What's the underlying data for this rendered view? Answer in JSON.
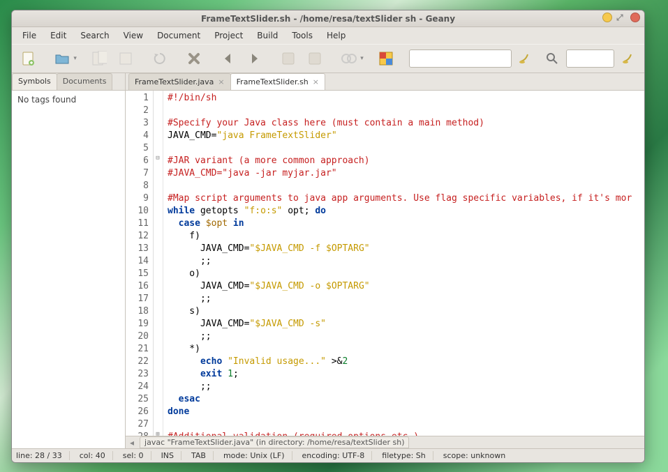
{
  "window": {
    "title": "FrameTextSlider.sh - /home/resa/textSlider sh - Geany"
  },
  "menu": {
    "items": [
      "File",
      "Edit",
      "Search",
      "View",
      "Document",
      "Project",
      "Build",
      "Tools",
      "Help"
    ]
  },
  "toolbar": {
    "icons": [
      "new-file",
      "open-file",
      "save-file",
      "save-all",
      "revert",
      "close",
      "undo",
      "redo",
      "back",
      "forward",
      "compile",
      "build",
      "execute",
      "color-picker"
    ],
    "search_placeholder": "",
    "search_value": "",
    "goto_placeholder": "",
    "goto_value": ""
  },
  "sidebar": {
    "tabs": [
      "Symbols",
      "Documents"
    ],
    "active_tab": 0,
    "content": "No tags found"
  },
  "editor_tabs": [
    {
      "label": "FrameTextSlider.java",
      "active": false
    },
    {
      "label": "FrameTextSlider.sh",
      "active": true
    }
  ],
  "code_lines": [
    {
      "n": 1,
      "t": "comment",
      "text": "#!/bin/sh"
    },
    {
      "n": 2,
      "t": "blank",
      "text": ""
    },
    {
      "n": 3,
      "t": "comment",
      "text": "#Specify your Java class here (must contain a main method)"
    },
    {
      "n": 4,
      "t": "assign",
      "lhs": "JAVA_CMD=",
      "str": "\"java FrameTextSlider\""
    },
    {
      "n": 5,
      "t": "blank",
      "text": ""
    },
    {
      "n": 6,
      "t": "comment",
      "text": "#JAR variant (a more common approach)",
      "fold": "minus"
    },
    {
      "n": 7,
      "t": "comment",
      "text": "#JAVA_CMD=\"java -jar myjar.jar\""
    },
    {
      "n": 8,
      "t": "blank",
      "text": ""
    },
    {
      "n": 9,
      "t": "comment",
      "text": "#Map script arguments to java app arguments. Use flag specific variables, if it's mor"
    },
    {
      "n": 10,
      "t": "while",
      "kw1": "while",
      "mid": " getopts ",
      "str": "\"f:o:s\"",
      "mid2": " opt; ",
      "kw2": "do"
    },
    {
      "n": 11,
      "t": "case",
      "indent": "  ",
      "kw1": "case ",
      "var": "$opt",
      "kw2": " in"
    },
    {
      "n": 12,
      "t": "plain",
      "text": "    f)"
    },
    {
      "n": 13,
      "t": "assign2",
      "indent": "      ",
      "lhs": "JAVA_CMD=",
      "str": "\"$JAVA_CMD -f $OPTARG\""
    },
    {
      "n": 14,
      "t": "plain",
      "text": "      ;;"
    },
    {
      "n": 15,
      "t": "plain",
      "text": "    o)"
    },
    {
      "n": 16,
      "t": "assign2",
      "indent": "      ",
      "lhs": "JAVA_CMD=",
      "str": "\"$JAVA_CMD -o $OPTARG\""
    },
    {
      "n": 17,
      "t": "plain",
      "text": "      ;;"
    },
    {
      "n": 18,
      "t": "plain",
      "text": "    s)"
    },
    {
      "n": 19,
      "t": "assign2",
      "indent": "      ",
      "lhs": "JAVA_CMD=",
      "str": "\"$JAVA_CMD -s\""
    },
    {
      "n": 20,
      "t": "plain",
      "text": "      ;;"
    },
    {
      "n": 21,
      "t": "plain",
      "text": "    *)"
    },
    {
      "n": 22,
      "t": "echo",
      "indent": "      ",
      "kw": "echo ",
      "str": "\"Invalid usage...\"",
      "rest": " >&",
      "num": "2"
    },
    {
      "n": 23,
      "t": "exit",
      "indent": "      ",
      "kw": "exit ",
      "num": "1",
      "rest": ";"
    },
    {
      "n": 24,
      "t": "plain",
      "text": "      ;;"
    },
    {
      "n": 25,
      "t": "kw",
      "indent": "  ",
      "kw": "esac"
    },
    {
      "n": 26,
      "t": "kw",
      "indent": "",
      "kw": "done"
    },
    {
      "n": 27,
      "t": "blank",
      "text": ""
    },
    {
      "n": 28,
      "t": "comment",
      "text": "#Additional validation (required options etc.)",
      "fold": "plus"
    }
  ],
  "bottom_message": "javac \"FrameTextSlider.java\" (in directory: /home/resa/textSlider sh)",
  "status": {
    "line": "line: 28 / 33",
    "col": "col: 40",
    "sel": "sel: 0",
    "ins": "INS",
    "tab": "TAB",
    "mode": "mode: Unix (LF)",
    "encoding": "encoding: UTF-8",
    "filetype": "filetype: Sh",
    "scope": "scope: unknown"
  }
}
